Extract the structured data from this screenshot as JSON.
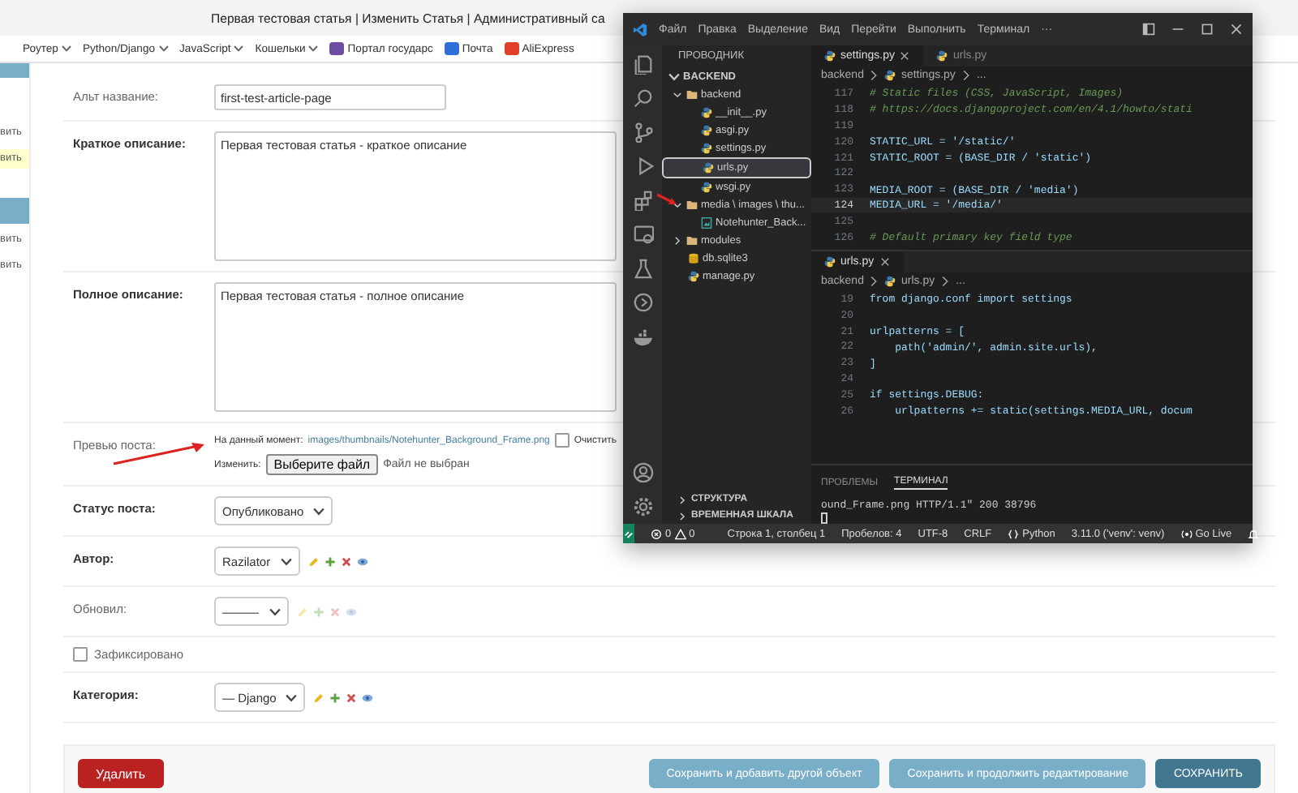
{
  "browser": {
    "title": "Первая тестовая статья | Изменить Статья | Административный са",
    "bookmarks": [
      {
        "label": "Роутер",
        "kind": "folder"
      },
      {
        "label": "Python/Django",
        "kind": "folder"
      },
      {
        "label": "JavaScript",
        "kind": "folder"
      },
      {
        "label": "Кошельки",
        "kind": "folder"
      },
      {
        "label": "Портал государс",
        "kind": "link",
        "color": "#6a4fa0"
      },
      {
        "label": "Почта",
        "kind": "link",
        "color": "#2f6fd6"
      },
      {
        "label": "AliExpress",
        "kind": "link",
        "color": "#e0402a"
      }
    ]
  },
  "left_panel": {
    "items": [
      {
        "kind": "bar"
      },
      {
        "kind": "text",
        "text": "вить",
        "highlighted": false
      },
      {
        "kind": "text",
        "text": "вить",
        "highlighted": true
      },
      {
        "kind": "bar"
      },
      {
        "kind": "text",
        "text": "вить",
        "highlighted": false
      },
      {
        "kind": "text",
        "text": "вить",
        "highlighted": false
      }
    ]
  },
  "form": {
    "rows": [
      {
        "kind": "text",
        "label": "Альт название:",
        "required": false,
        "value": "first-test-article-page"
      },
      {
        "kind": "textarea",
        "label": "Краткое описание:",
        "required": true,
        "value": "Первая тестовая статья - краткое описание"
      },
      {
        "kind": "textarea",
        "label": "Полное описание:",
        "required": true,
        "value": "Первая тестовая статья - полное описание"
      },
      {
        "kind": "file",
        "label": "Превью поста:",
        "required": false,
        "current_label": "На данный момент:",
        "current_link": "images/thumbnails/Notehunter_Background_Frame.png",
        "clear_checked": false,
        "clear_label": "Очистить",
        "change_label": "Изменить:",
        "button": "Выберите файл",
        "no_file": "Файл не выбран"
      },
      {
        "kind": "select",
        "label": "Статус поста:",
        "required": true,
        "value": "Опубликовано",
        "actions": false
      },
      {
        "kind": "select",
        "label": "Автор:",
        "required": true,
        "value": "Razilator",
        "actions": true,
        "actions_enabled": true
      },
      {
        "kind": "select",
        "label": "Обновил:",
        "required": false,
        "value": "———",
        "actions": true,
        "actions_enabled": false
      },
      {
        "kind": "checkbox",
        "label": "Зафиксировано",
        "checked": false
      },
      {
        "kind": "select",
        "label": "Категория:",
        "required": true,
        "value": "— Django",
        "actions": true,
        "actions_enabled": true
      }
    ],
    "buttons": [
      {
        "label": "Удалить",
        "kind": "danger"
      },
      {
        "label": "Сохранить и добавить другой объект",
        "kind": "secondary"
      },
      {
        "label": "Сохранить и продолжить редактирование",
        "kind": "secondary"
      },
      {
        "label": "СОХРАНИТЬ",
        "kind": "primary"
      }
    ]
  },
  "editor_window": {
    "menu": [
      "Файл",
      "Правка",
      "Выделение",
      "Вид",
      "Перейти",
      "Выполнить",
      "Терминал",
      "···"
    ],
    "explorer": {
      "title": "ПРОВОДНИК",
      "root": "BACKEND",
      "tree": [
        {
          "name": "backend",
          "kind": "folder",
          "expanded": true,
          "selected": false,
          "children": [
            {
              "name": "__init__.py",
              "kind": "python",
              "selected": false
            },
            {
              "name": "asgi.py",
              "kind": "python",
              "selected": false
            },
            {
              "name": "settings.py",
              "kind": "python",
              "selected": false
            },
            {
              "name": "urls.py",
              "kind": "python",
              "selected": true
            },
            {
              "name": "wsgi.py",
              "kind": "python",
              "selected": false
            }
          ]
        },
        {
          "name": "media \\ images \\ thu...",
          "kind": "folder",
          "expanded": true,
          "selected": false,
          "children": [
            {
              "name": "Notehunter_Back...",
              "kind": "image",
              "selected": false
            }
          ]
        },
        {
          "name": "modules",
          "kind": "folder",
          "expanded": false,
          "selected": false
        },
        {
          "name": "db.sqlite3",
          "kind": "database",
          "selected": false
        },
        {
          "name": "manage.py",
          "kind": "python",
          "selected": false
        }
      ],
      "sections": [
        "СТРУКТУРА",
        "ВРЕМЕННАЯ ШКАЛА"
      ]
    },
    "groups": [
      {
        "tabs": [
          {
            "label": "settings.py",
            "selected": true
          },
          {
            "label": "urls.py",
            "selected": false
          }
        ],
        "breadcrumb": [
          "backend",
          "settings.py",
          "..."
        ],
        "lines": [
          {
            "number": "117",
            "text": "# Static files (CSS, JavaScript, Images)",
            "kind": "comment",
            "current": false
          },
          {
            "number": "118",
            "text": "# https://docs.djangoproject.com/en/4.1/howto/stati",
            "kind": "comment",
            "current": false
          },
          {
            "number": "119",
            "kind": "code",
            "current": false
          },
          {
            "number": "120",
            "text": "STATIC_URL = '/static/'",
            "kind": "code",
            "current": false
          },
          {
            "number": "121",
            "text": "STATIC_ROOT = (BASE_DIR / 'static')",
            "kind": "code",
            "current": false
          },
          {
            "number": "122",
            "kind": "code",
            "current": false
          },
          {
            "number": "123",
            "text": "MEDIA_ROOT = (BASE_DIR / 'media')",
            "kind": "code",
            "current": false
          },
          {
            "number": "124",
            "text": "MEDIA_URL = '/media/'",
            "kind": "code",
            "current": true
          },
          {
            "number": "125",
            "kind": "code",
            "current": false
          },
          {
            "number": "126",
            "text": "# Default primary key field type",
            "kind": "comment",
            "current": false
          }
        ]
      },
      {
        "tabs": [
          {
            "label": "urls.py",
            "selected": true
          }
        ],
        "breadcrumb": [
          "backend",
          "urls.py",
          "..."
        ],
        "lines": [
          {
            "number": "19",
            "text": "from django.conf import settings",
            "kind": "code",
            "current": false
          },
          {
            "number": "20",
            "kind": "code",
            "current": false
          },
          {
            "number": "21",
            "text": "urlpatterns = [",
            "kind": "code",
            "current": false
          },
          {
            "number": "22",
            "text": "    path('admin/', admin.site.urls),",
            "kind": "code",
            "current": false
          },
          {
            "number": "23",
            "text": "]",
            "kind": "code",
            "current": false
          },
          {
            "number": "24",
            "kind": "code",
            "current": false
          },
          {
            "number": "25",
            "text": "if settings.DEBUG:",
            "kind": "code",
            "current": false
          },
          {
            "number": "26",
            "text": "    urlpatterns += static(settings.MEDIA_URL, docum",
            "kind": "code",
            "current": false
          }
        ]
      }
    ],
    "panel": {
      "tabs": [
        {
          "label": "ПРОБЛЕМЫ",
          "selected": false
        },
        {
          "label": "ТЕРМИНАЛ",
          "selected": true
        }
      ],
      "output": "ound_Frame.png HTTP/1.1\" 200 38796"
    },
    "status_bar": {
      "errors": "0",
      "warnings": "0",
      "items": [
        {
          "text": "Строка 1, столбец 1",
          "kind": "plain"
        },
        {
          "text": "Пробелов: 4",
          "kind": "plain"
        },
        {
          "text": "UTF-8",
          "kind": "plain"
        },
        {
          "text": "CRLF",
          "kind": "plain"
        },
        {
          "text": "Python",
          "kind": "language"
        },
        {
          "text": "3.11.0 ('venv': venv)",
          "kind": "plain"
        },
        {
          "text": "Go Live",
          "kind": "live"
        }
      ]
    }
  }
}
